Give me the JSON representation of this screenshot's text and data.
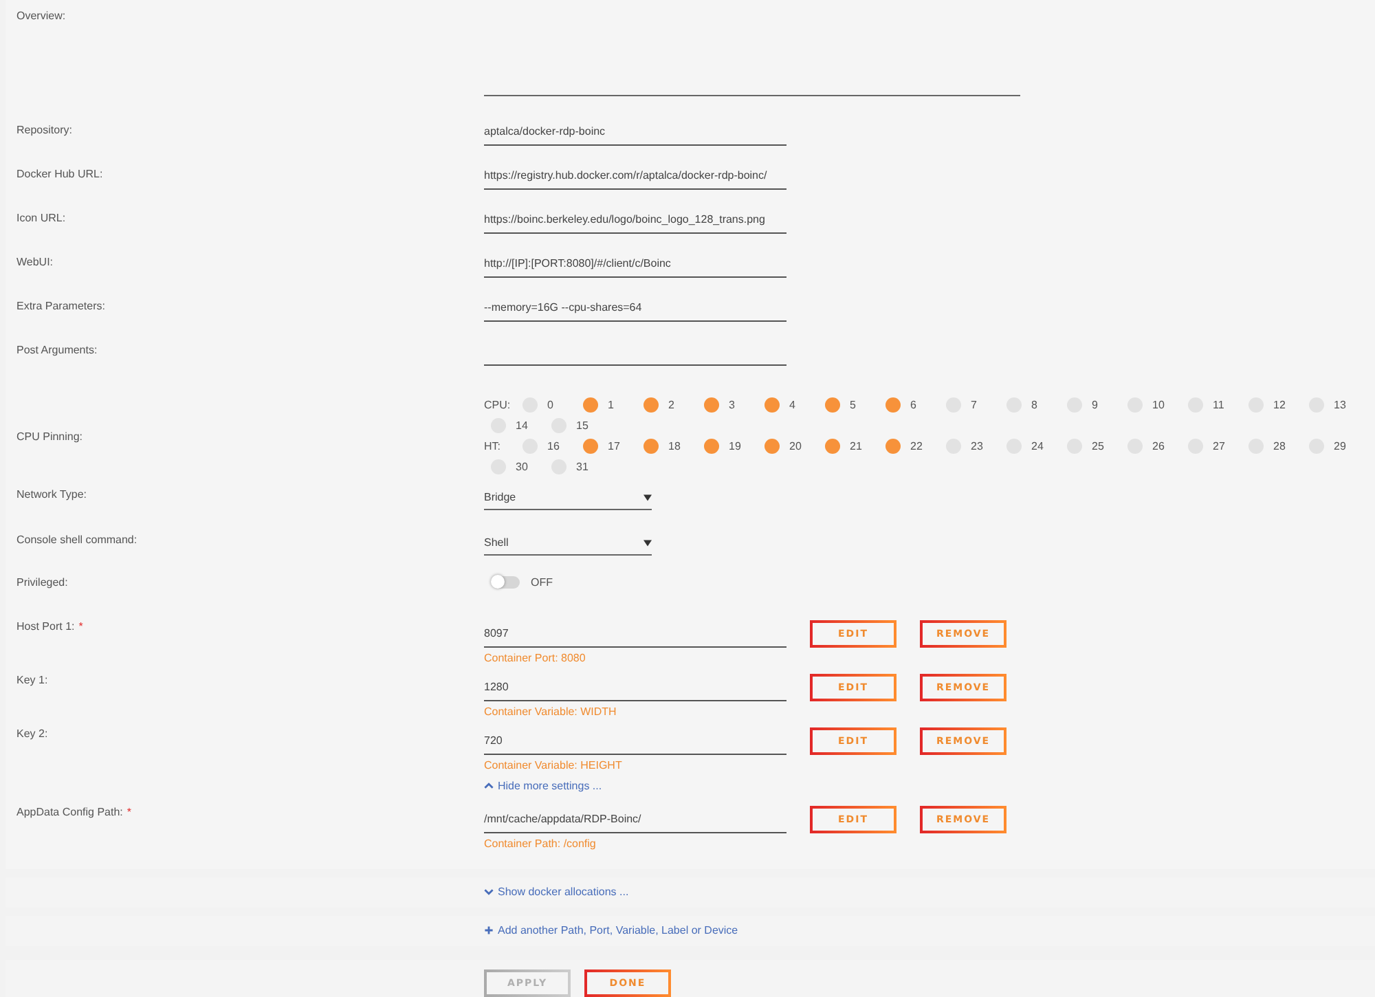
{
  "rows": [
    {
      "kind": "textarea",
      "label": "Overview:"
    },
    {
      "kind": "text",
      "label": "Repository:",
      "value": "aptalca/docker-rdp-boinc"
    },
    {
      "kind": "text",
      "label": "Docker Hub URL:",
      "value": "https://registry.hub.docker.com/r/aptalca/docker-rdp-boinc/"
    },
    {
      "kind": "text",
      "label": "Icon URL:",
      "value": "https://boinc.berkeley.edu/logo/boinc_logo_128_trans.png"
    },
    {
      "kind": "text",
      "label": "WebUI:",
      "value": "http://[IP]:[PORT:8080]/#/client/c/Boinc"
    },
    {
      "kind": "text",
      "label": "Extra Parameters:",
      "value": "--memory=16G --cpu-shares=64"
    },
    {
      "kind": "text",
      "label": "Post Arguments:"
    },
    {
      "kind": "pinning",
      "label": "CPU Pinning:",
      "groups": [
        {
          "label": "CPU:",
          "pins": [
            {
              "label": "0",
              "selected": false
            },
            {
              "label": "1",
              "selected": true
            },
            {
              "label": "2",
              "selected": true
            },
            {
              "label": "3",
              "selected": true
            },
            {
              "label": "4",
              "selected": true
            },
            {
              "label": "5",
              "selected": true
            },
            {
              "label": "6",
              "selected": true
            },
            {
              "label": "7",
              "selected": false
            },
            {
              "label": "8",
              "selected": false
            },
            {
              "label": "9",
              "selected": false
            },
            {
              "label": "10",
              "selected": false
            },
            {
              "label": "11",
              "selected": false
            },
            {
              "label": "12",
              "selected": false
            },
            {
              "label": "13",
              "selected": false
            },
            {
              "label": "14",
              "selected": false
            },
            {
              "label": "15",
              "selected": false
            }
          ]
        },
        {
          "label": "HT:",
          "pins": [
            {
              "label": "16",
              "selected": false
            },
            {
              "label": "17",
              "selected": true
            },
            {
              "label": "18",
              "selected": true
            },
            {
              "label": "19",
              "selected": true
            },
            {
              "label": "20",
              "selected": true
            },
            {
              "label": "21",
              "selected": true
            },
            {
              "label": "22",
              "selected": true
            },
            {
              "label": "23",
              "selected": false
            },
            {
              "label": "24",
              "selected": false
            },
            {
              "label": "25",
              "selected": false
            },
            {
              "label": "26",
              "selected": false
            },
            {
              "label": "27",
              "selected": false
            },
            {
              "label": "28",
              "selected": false
            },
            {
              "label": "29",
              "selected": false
            },
            {
              "label": "30",
              "selected": false
            },
            {
              "label": "31",
              "selected": false
            }
          ]
        }
      ]
    },
    {
      "kind": "select",
      "label": "Network Type:",
      "value": "Bridge"
    },
    {
      "kind": "select",
      "label": "Console shell command:",
      "value": "Shell"
    },
    {
      "kind": "toggle",
      "label": "Privileged:",
      "on": false,
      "state_text": "OFF"
    },
    {
      "kind": "config",
      "label": "Host Port 1:",
      "required_mark": "*",
      "value": "8097",
      "help": "Container Port: 8080",
      "edit": "EDIT",
      "remove": "REMOVE"
    },
    {
      "kind": "config",
      "label": "Key 1:",
      "value": "1280",
      "help": "Container Variable: WIDTH",
      "edit": "EDIT",
      "remove": "REMOVE"
    },
    {
      "kind": "config",
      "label": "Key 2:",
      "value": "720",
      "help": "Container Variable: HEIGHT",
      "edit": "EDIT",
      "remove": "REMOVE"
    },
    {
      "kind": "collapse",
      "text": "Hide more settings ..."
    },
    {
      "kind": "config",
      "label": "AppData Config Path:",
      "required_mark": "*",
      "value": "/mnt/cache/appdata/RDP-Boinc/",
      "help": "Container Path: /config",
      "edit": "EDIT",
      "remove": "REMOVE"
    }
  ],
  "bands": [
    {
      "kind": "expand",
      "text": "Show docker allocations ..."
    },
    {
      "kind": "add",
      "text": "Add another Path, Port, Variable, Label or Device"
    }
  ],
  "actions": [
    {
      "label": "APPLY",
      "disabled": true
    },
    {
      "label": "DONE",
      "disabled": false
    }
  ]
}
